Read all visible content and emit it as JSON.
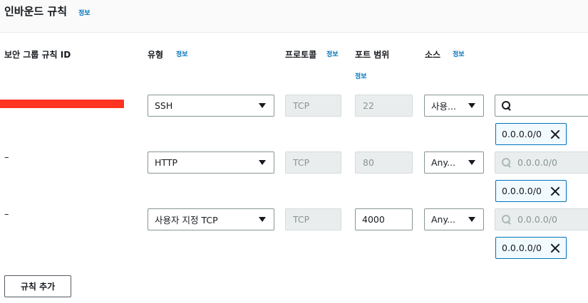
{
  "section": {
    "title": "인바운드 규칙",
    "info": "정보"
  },
  "columns": {
    "rule_id": "보안 그룹 규칙 ID",
    "type": "유형",
    "type_info": "정보",
    "protocol": "프로토콜",
    "protocol_info": "정보",
    "port_range": "포트 범위",
    "port_info": "정보",
    "source": "소스",
    "source_info": "정보"
  },
  "rules": [
    {
      "rule_id": "",
      "type": "SSH",
      "protocol": "TCP",
      "port": "22",
      "source_type": "사용...",
      "source_search": "",
      "source_token": "0.0.0.0/0"
    },
    {
      "rule_id": "–",
      "type": "HTTP",
      "protocol": "TCP",
      "port": "80",
      "source_type": "Any...",
      "source_search": "0.0.0.0/0",
      "source_token": "0.0.0.0/0"
    },
    {
      "rule_id": "–",
      "type": "사용자 지정 TCP",
      "protocol": "TCP",
      "port": "4000",
      "source_type": "Any...",
      "source_search": "0.0.0.0/0",
      "source_token": "0.0.0.0/0"
    }
  ],
  "add_rule_label": "규칙 추가",
  "colors": {
    "link": "#0073bb",
    "redaction": "#ff3322",
    "token_bg": "#f1faff"
  },
  "icons": [
    "search-icon",
    "caret-down-icon",
    "close-icon"
  ]
}
